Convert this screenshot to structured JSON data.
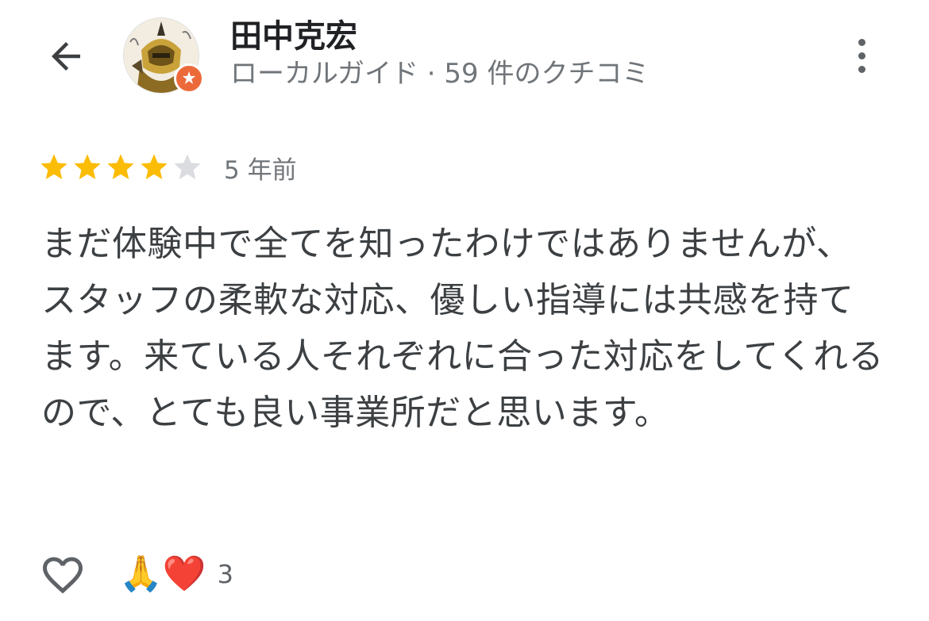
{
  "header": {
    "back_icon": "arrow-left-icon",
    "user_name": "田中克宏",
    "user_meta": "ローカルガイド · 59 件のクチコミ",
    "badge_icon": "local-guide-star-icon",
    "more_icon": "more-vertical-icon"
  },
  "review": {
    "rating": 4,
    "max_rating": 5,
    "date": "5 年前",
    "text": "まだ体験中で全てを知ったわけではありませんが、スタッフの柔軟な対応、優しい指導には共感を持てます。来ている人それぞれに合った対応をしてくれるので、とても良い事業所だと思います。"
  },
  "reactions": {
    "like_icon": "heart-outline-icon",
    "emojis": "🙏❤️",
    "count": "3"
  },
  "colors": {
    "star_filled": "#fbbc04",
    "star_empty": "#dadce0",
    "badge": "#ec6a3a",
    "meta_text": "#70757a"
  }
}
